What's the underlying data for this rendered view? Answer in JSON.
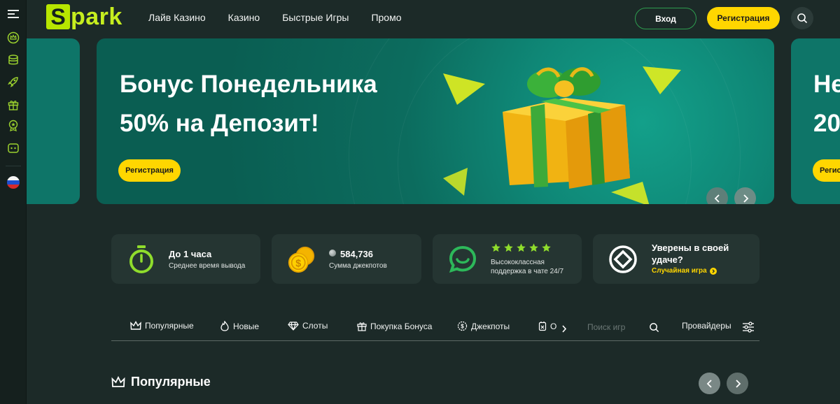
{
  "brand": {
    "logo_letter": "S",
    "logo_rest": "park"
  },
  "nav": {
    "items": [
      "Лайв Казино",
      "Казино",
      "Быстрые Игры",
      "Промо"
    ]
  },
  "header": {
    "login_label": "Вход",
    "register_label": "Регистрация"
  },
  "rail": {
    "icons": [
      "menu-icon",
      "crown-icon",
      "coins-icon",
      "rocket-icon",
      "gift-icon",
      "badge-icon",
      "chat-icon",
      "flag-ru-icon"
    ]
  },
  "banner": {
    "title_line1": "Бонус Понедельника",
    "title_line2": "50% на Депозит!",
    "cta_label": "Регистрация",
    "next_peek_line1": "Не",
    "next_peek_line2": "20",
    "next_peek_cta": "Регис"
  },
  "cards": [
    {
      "title": "До 1 часа",
      "subtitle": "Среднее время вывода"
    },
    {
      "title": "584,736",
      "subtitle": "Сумма джекпотов"
    },
    {
      "subtitle": "Высококлассная поддержка в чате 24/7",
      "stars": 5
    },
    {
      "title_line1": "Уверены в своей",
      "title_line2": "удаче?",
      "link": "Случайная игра"
    }
  ],
  "categories": {
    "items": [
      "Популярные",
      "Новые",
      "Слоты",
      "Покупка Бонуса",
      "Джекпоты",
      "О"
    ],
    "search_placeholder": "Поиск игр",
    "providers_label": "Провайдеры"
  },
  "section": {
    "title": "Популярные"
  },
  "colors": {
    "accent_yellow": "#ffd600",
    "brand_green": "#c6ee1f",
    "outline_green": "#2e9d4f",
    "background": "#1c2a28",
    "card": "#253532"
  }
}
